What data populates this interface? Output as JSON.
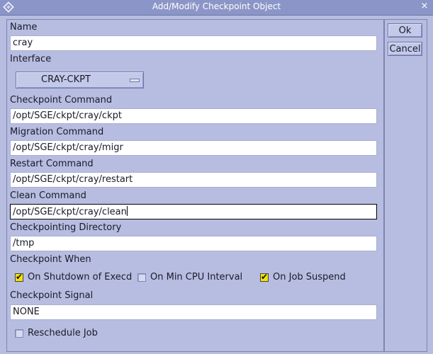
{
  "window": {
    "title": "Add/Modify Checkpoint Object",
    "close_glyph": "×"
  },
  "form": {
    "name_label": "Name",
    "name_value": "cray",
    "interface_label": "Interface",
    "interface_value": "CRAY-CKPT",
    "checkpoint_command_label": "Checkpoint Command",
    "checkpoint_command_value": "/opt/SGE/ckpt/cray/ckpt",
    "migration_command_label": "Migration Command",
    "migration_command_value": "/opt/SGE/ckpt/cray/migr",
    "restart_command_label": "Restart Command",
    "restart_command_value": "/opt/SGE/ckpt/cray/restart",
    "clean_command_label": "Clean Command",
    "clean_command_value": "/opt/SGE/ckpt/cray/clean",
    "checkpointing_directory_label": "Checkpointing Directory",
    "checkpointing_directory_value": "/tmp",
    "checkpoint_when_label": "Checkpoint When",
    "when_options": [
      {
        "label": "On Shutdown of Execd",
        "checked": true
      },
      {
        "label": "On Min CPU Interval",
        "checked": false
      },
      {
        "label": "On Job Suspend",
        "checked": true
      }
    ],
    "checkpoint_signal_label": "Checkpoint Signal",
    "checkpoint_signal_value": "NONE",
    "reschedule_label": "Reschedule Job",
    "reschedule_checked": false
  },
  "actions": {
    "ok_label": "Ok",
    "cancel_label": "Cancel"
  },
  "colors": {
    "background": "#b6bde0",
    "titlebar": "#8c95c7",
    "checkbox_checked": "#f4e400"
  },
  "icons": {
    "window_menu": "diamond-icon",
    "window_close": "close-icon",
    "checked": "checkmark-icon"
  }
}
